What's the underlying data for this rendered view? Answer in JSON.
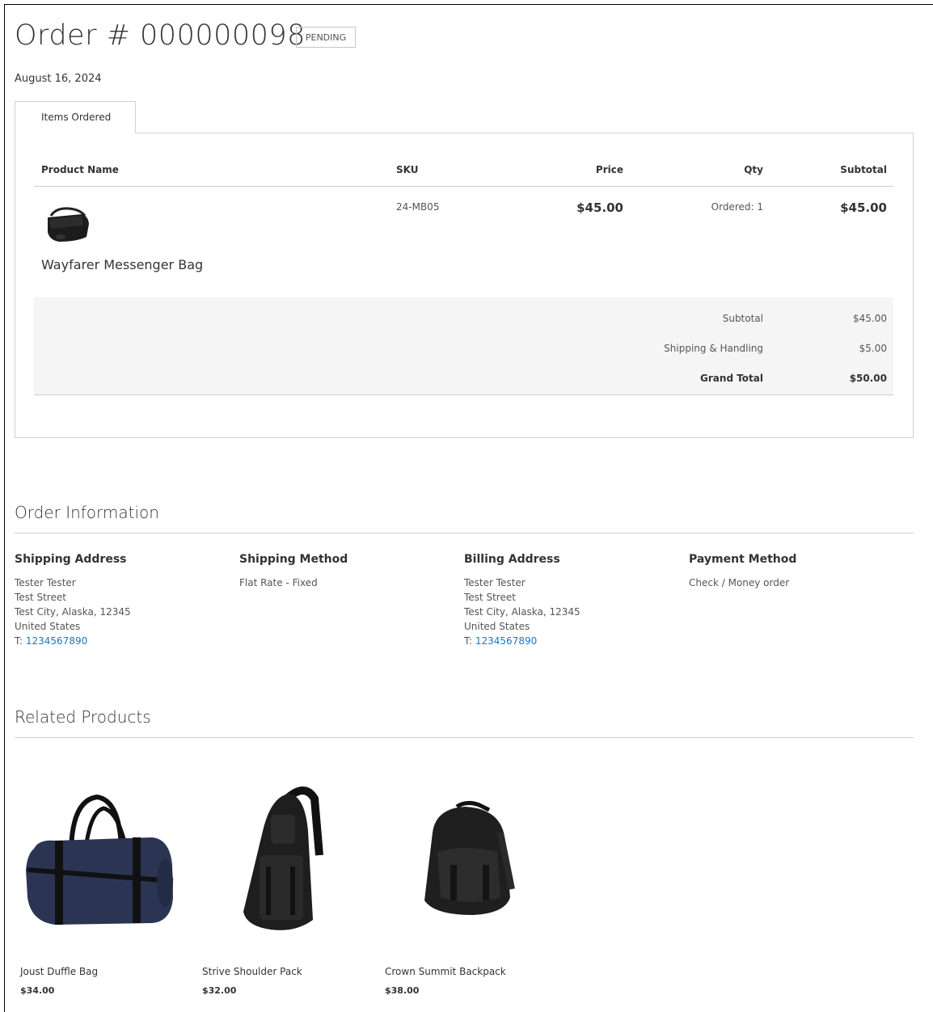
{
  "order": {
    "title": "Order # 000000098",
    "status": "PENDING",
    "date": "August 16, 2024"
  },
  "tabs": [
    {
      "label": "Items Ordered"
    }
  ],
  "items_table": {
    "headers": {
      "product_name": "Product Name",
      "sku": "SKU",
      "price": "Price",
      "qty": "Qty",
      "subtotal": "Subtotal"
    },
    "rows": [
      {
        "name": "Wayfarer Messenger Bag",
        "sku": "24-MB05",
        "price": "$45.00",
        "qty": "Ordered: 1",
        "subtotal": "$45.00",
        "image_icon": "messenger-bag-image"
      }
    ]
  },
  "totals": {
    "subtotal_label": "Subtotal",
    "subtotal_value": "$45.00",
    "shipping_label": "Shipping & Handling",
    "shipping_value": "$5.00",
    "grand_total_label": "Grand Total",
    "grand_total_value": "$50.00"
  },
  "order_information": {
    "title": "Order Information",
    "shipping_address": {
      "heading": "Shipping Address",
      "name": "Tester Tester",
      "street": "Test Street",
      "city_line": "Test City, Alaska, 12345",
      "country": "United States",
      "phone_prefix": "T: ",
      "phone": "1234567890"
    },
    "shipping_method": {
      "heading": "Shipping Method",
      "value": "Flat Rate - Fixed"
    },
    "billing_address": {
      "heading": "Billing Address",
      "name": "Tester Tester",
      "street": "Test Street",
      "city_line": "Test City, Alaska, 12345",
      "country": "United States",
      "phone_prefix": "T: ",
      "phone": "1234567890"
    },
    "payment_method": {
      "heading": "Payment Method",
      "value": "Check / Money order"
    }
  },
  "related_products": {
    "title": "Related Products",
    "items": [
      {
        "name": "Joust Duffle Bag",
        "price": "$34.00",
        "image_icon": "duffle-bag-image"
      },
      {
        "name": "Strive Shoulder Pack",
        "price": "$32.00",
        "image_icon": "shoulder-pack-image"
      },
      {
        "name": "Crown Summit Backpack",
        "price": "$38.00",
        "image_icon": "backpack-image"
      }
    ]
  },
  "colors": {
    "link": "#1979c3",
    "border": "#d1d1d1",
    "totals_bg": "#f5f5f5"
  }
}
